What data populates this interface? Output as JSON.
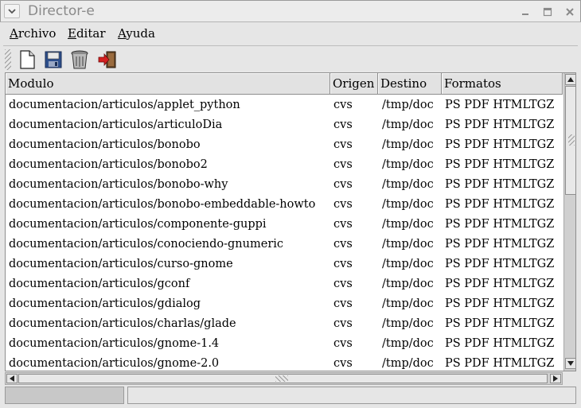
{
  "window": {
    "title": "Director-e"
  },
  "menubar": {
    "items": [
      {
        "mnemonic": "A",
        "rest": "rchivo"
      },
      {
        "mnemonic": "E",
        "rest": "ditar"
      },
      {
        "mnemonic": "A",
        "rest": "yuda"
      }
    ]
  },
  "toolbar": {
    "icons": [
      "new-document-icon",
      "save-floppy-icon",
      "trash-can-icon",
      "exit-door-icon"
    ]
  },
  "table": {
    "columns": [
      "Modulo",
      "Origen",
      "Destino",
      "Formatos"
    ],
    "rows": [
      [
        "documentacion/articulos/applet_python",
        "cvs",
        "/tmp/doc",
        "PS PDF HTMLTGZ"
      ],
      [
        "documentacion/articulos/articuloDia",
        "cvs",
        "/tmp/doc",
        "PS PDF HTMLTGZ"
      ],
      [
        "documentacion/articulos/bonobo",
        "cvs",
        "/tmp/doc",
        "PS PDF HTMLTGZ"
      ],
      [
        "documentacion/articulos/bonobo2",
        "cvs",
        "/tmp/doc",
        "PS PDF HTMLTGZ"
      ],
      [
        "documentacion/articulos/bonobo-why",
        "cvs",
        "/tmp/doc",
        "PS PDF HTMLTGZ"
      ],
      [
        "documentacion/articulos/bonobo-embeddable-howto",
        "cvs",
        "/tmp/doc",
        "PS PDF HTMLTGZ"
      ],
      [
        "documentacion/articulos/componente-guppi",
        "cvs",
        "/tmp/doc",
        "PS PDF HTMLTGZ"
      ],
      [
        "documentacion/articulos/conociendo-gnumeric",
        "cvs",
        "/tmp/doc",
        "PS PDF HTMLTGZ"
      ],
      [
        "documentacion/articulos/curso-gnome",
        "cvs",
        "/tmp/doc",
        "PS PDF HTMLTGZ"
      ],
      [
        "documentacion/articulos/gconf",
        "cvs",
        "/tmp/doc",
        "PS PDF HTMLTGZ"
      ],
      [
        "documentacion/articulos/gdialog",
        "cvs",
        "/tmp/doc",
        "PS PDF HTMLTGZ"
      ],
      [
        "documentacion/articulos/charlas/glade",
        "cvs",
        "/tmp/doc",
        "PS PDF HTMLTGZ"
      ],
      [
        "documentacion/articulos/gnome-1.4",
        "cvs",
        "/tmp/doc",
        "PS PDF HTMLTGZ"
      ],
      [
        "documentacion/articulos/gnome-2.0",
        "cvs",
        "/tmp/doc",
        "PS PDF HTMLTGZ"
      ]
    ]
  },
  "statusbar": {
    "progress": 0,
    "text": ""
  }
}
